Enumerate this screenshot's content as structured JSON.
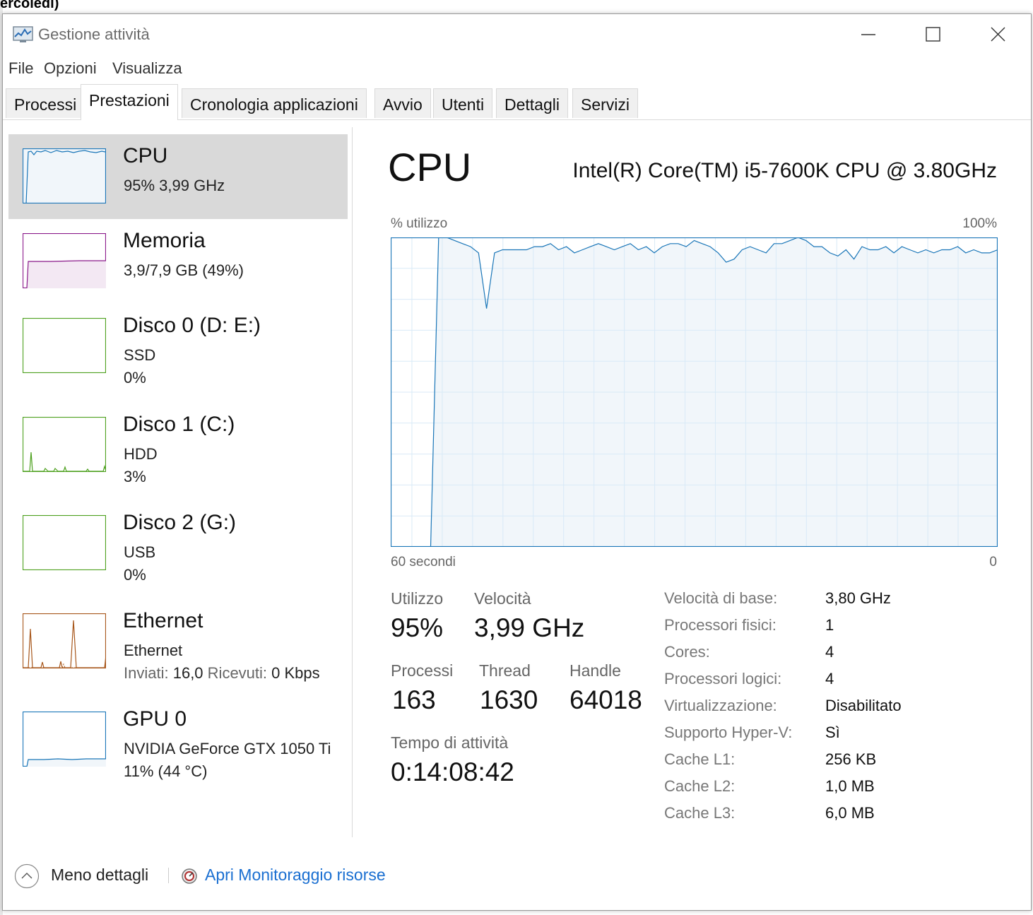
{
  "background_text": "ercoledì)",
  "window": {
    "title": "Gestione attività",
    "icon": "task-manager-icon",
    "controls": [
      "minimize-icon",
      "maximize-icon",
      "close-icon"
    ]
  },
  "menu": [
    "File",
    "Opzioni",
    "Visualizza"
  ],
  "tabs": [
    {
      "label": "Processi"
    },
    {
      "label": "Prestazioni",
      "active": true
    },
    {
      "label": "Cronologia applicazioni"
    },
    {
      "label": "Avvio"
    },
    {
      "label": "Utenti"
    },
    {
      "label": "Dettagli"
    },
    {
      "label": "Servizi"
    }
  ],
  "sidebar": [
    {
      "title": "CPU",
      "lines": [
        "95%  3,99 GHz"
      ],
      "color": "#1a76b8",
      "selected": true
    },
    {
      "title": "Memoria",
      "lines": [
        "3,9/7,9 GB (49%)"
      ],
      "color": "#8b1a8b"
    },
    {
      "title": "Disco 0 (D: E:)",
      "lines": [
        "SSD",
        "0%"
      ],
      "color": "#4da01e"
    },
    {
      "title": "Disco 1 (C:)",
      "lines": [
        "HDD",
        "3%"
      ],
      "color": "#4da01e"
    },
    {
      "title": "Disco 2 (G:)",
      "lines": [
        "USB",
        "0%"
      ],
      "color": "#4da01e"
    },
    {
      "title": "Ethernet",
      "lines": [
        "Ethernet"
      ],
      "network": {
        "sent_label": "Inviati:",
        "sent_value": "16,0",
        "recv_label": "Ricevuti:",
        "recv_value": "0 Kbps"
      },
      "color": "#a7561a"
    },
    {
      "title": "GPU 0",
      "lines": [
        "NVIDIA GeForce GTX 1050 Ti",
        "11%  (44 °C)"
      ],
      "color": "#1a76b8"
    }
  ],
  "main": {
    "title": "CPU",
    "cpu_name": "Intel(R) Core(TM) i5-7600K CPU @ 3.80GHz",
    "graph": {
      "y_label": "% utilizzo",
      "y_max": "100%",
      "x_left": "60 secondi",
      "x_right": "0",
      "line_color": "#1a76b8",
      "fill_color": "#f1f6fa",
      "grid_color": "#d9eaf7",
      "values": [
        0,
        0,
        0,
        0,
        0,
        0,
        100,
        100,
        99,
        98,
        97,
        95,
        77,
        95,
        96,
        96,
        96,
        96,
        97,
        97,
        98,
        96,
        97,
        95,
        96,
        97,
        98,
        97,
        96,
        97,
        98,
        96,
        97,
        95,
        97,
        98,
        98,
        97,
        99,
        98,
        97,
        95,
        92,
        93,
        96,
        97,
        96,
        95,
        98,
        98,
        99,
        100,
        99,
        97,
        97,
        95,
        94,
        96,
        93,
        97,
        96,
        96,
        97,
        95,
        97,
        96,
        95,
        96,
        95,
        96,
        96,
        97,
        95,
        96,
        95,
        95,
        96
      ]
    },
    "stats": {
      "utilizzo_label": "Utilizzo",
      "utilizzo_value": "95%",
      "velocita_label": "Velocità",
      "velocita_value": "3,99 GHz",
      "processi_label": "Processi",
      "processi_value": "163",
      "thread_label": "Thread",
      "thread_value": "1630",
      "handle_label": "Handle",
      "handle_value": "64018",
      "uptime_label": "Tempo di attività",
      "uptime_value": "0:14:08:42"
    },
    "info": [
      {
        "label": "Velocità di base:",
        "value": "3,80 GHz"
      },
      {
        "label": "Processori fisici:",
        "value": "1"
      },
      {
        "label": "Cores:",
        "value": "4"
      },
      {
        "label": "Processori logici:",
        "value": "4"
      },
      {
        "label": "Virtualizzazione:",
        "value": "Disabilitato"
      },
      {
        "label": "Supporto Hyper-V:",
        "value": "Sì"
      },
      {
        "label": "Cache L1:",
        "value": "256 KB"
      },
      {
        "label": "Cache L2:",
        "value": "1,0 MB"
      },
      {
        "label": "Cache L3:",
        "value": "6,0 MB"
      }
    ]
  },
  "footer": {
    "less_details": "Meno dettagli",
    "resource_monitor": "Apri Monitoraggio risorse"
  }
}
